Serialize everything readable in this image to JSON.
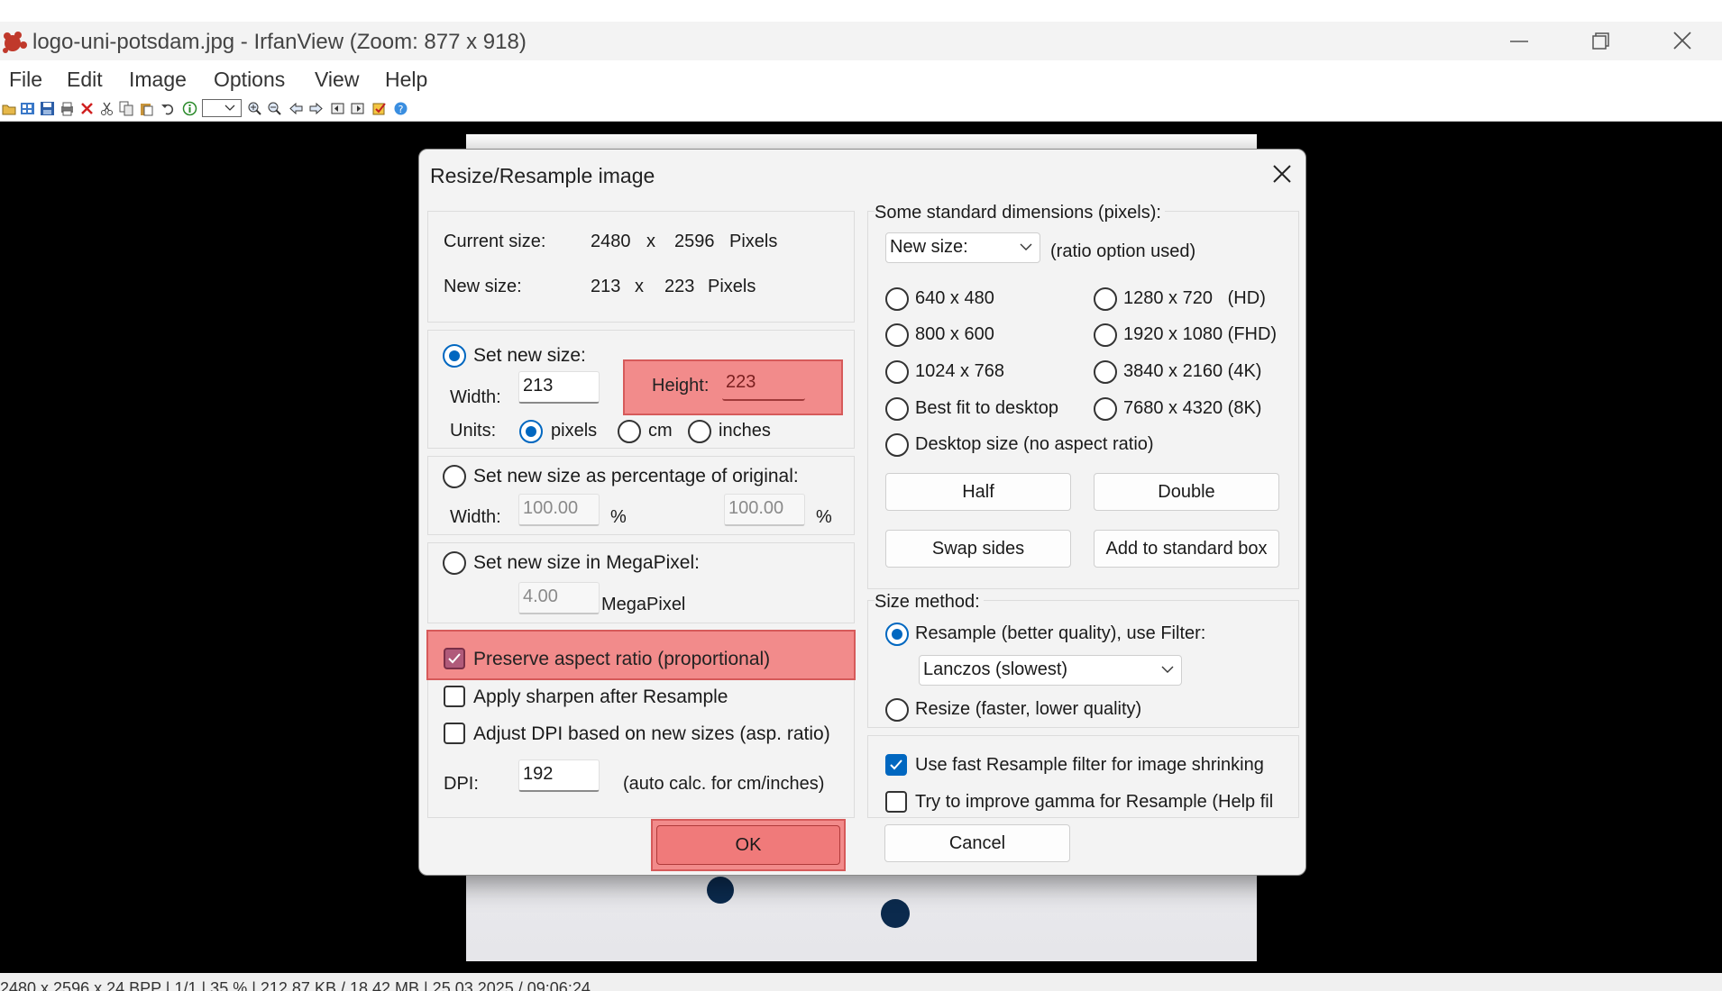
{
  "window": {
    "title": "logo-uni-potsdam.jpg - IrfanView (Zoom: 877 x 918)",
    "controls": [
      "minimize-icon",
      "restore-icon",
      "close-icon"
    ]
  },
  "menu": [
    "File",
    "Edit",
    "Image",
    "Options",
    "View",
    "Help"
  ],
  "toolbar_icons": [
    "open-icon",
    "thumbnails-icon",
    "save-icon",
    "print-icon",
    "delete-icon",
    "cut-icon",
    "copy-icon",
    "paste-icon",
    "undo-icon",
    "info-icon",
    "zoom-dropdown",
    "zoom-in-icon",
    "zoom-out-icon",
    "previous-icon",
    "next-icon",
    "first-icon",
    "last-icon",
    "paint-icon",
    "help-icon"
  ],
  "status": "2480 x 2596 x 24 BPP | 1/1 | 35 % | 212.87 KB / 18.42 MB | 25.03.2025 / 09:06:24",
  "dialog": {
    "title": "Resize/Resample image",
    "current_size_label": "Current size:",
    "current_w": "2480",
    "current_h": "2596",
    "x": "x",
    "pixels": "Pixels",
    "new_size_label": "New size:",
    "new_w": "213",
    "new_h": "223",
    "set_new_size": "Set new size:",
    "width_label": "Width:",
    "width_value": "213",
    "height_label": "Height:",
    "height_value": "223",
    "units_label": "Units:",
    "unit_pixels": "pixels",
    "unit_cm": "cm",
    "unit_inches": "inches",
    "set_percentage": "Set new size as percentage of original:",
    "pct_width_label": "Width:",
    "pct_width_value": "100.00",
    "pct_height_value": "100.00",
    "pct_sign": "%",
    "set_megapixel": "Set new size in MegaPixel:",
    "megapixel_value": "4.00",
    "megapixel_label": "MegaPixel",
    "preserve_aspect": "Preserve aspect ratio (proportional)",
    "apply_sharpen": "Apply sharpen after Resample",
    "adjust_dpi": "Adjust DPI based on new sizes (asp. ratio)",
    "dpi_label": "DPI:",
    "dpi_value": "192",
    "dpi_hint": "(auto calc. for cm/inches)",
    "std_title": "Some standard dimensions (pixels):",
    "std_select": "New size:",
    "std_ratio_hint": "(ratio option used)",
    "std_left": [
      "640 x 480",
      "800 x 600",
      "1024 x 768",
      "Best fit to desktop"
    ],
    "std_right": [
      "1280 x 720   (HD)",
      "1920 x 1080 (FHD)",
      "3840 x 2160 (4K)",
      "7680 x 4320 (8K)"
    ],
    "desktop_size": "Desktop size (no aspect ratio)",
    "half": "Half",
    "double": "Double",
    "swap_sides": "Swap sides",
    "add_to_std": "Add to standard box",
    "size_method": "Size method:",
    "resample": "Resample (better quality), use Filter:",
    "filter": "Lanczos (slowest)",
    "resize_fast": "Resize (faster, lower quality)",
    "use_fast_filter": "Use fast Resample filter for image shrinking",
    "improve_gamma": "Try to improve gamma for Resample (Help fil",
    "ok": "OK",
    "cancel": "Cancel"
  },
  "state": {
    "set_new_size_selected": true,
    "unit_selected": "pixels",
    "preserve_aspect_checked": true,
    "apply_sharpen_checked": false,
    "adjust_dpi_checked": false,
    "resample_selected": true,
    "use_fast_filter_checked": true,
    "improve_gamma_checked": false
  },
  "colors": {
    "highlight": "#f28b8b",
    "accent": "#0067c0",
    "canvas": "#000000",
    "dot": "#0b2a4d"
  }
}
